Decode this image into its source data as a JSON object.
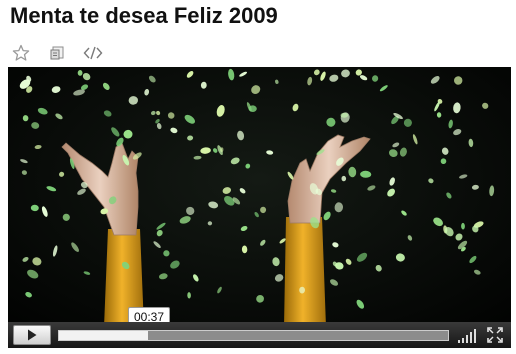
{
  "page": {
    "title": "Menta te desea Feliz 2009"
  },
  "toolbar": {
    "items": [
      {
        "name": "favorite",
        "icon": "star-icon"
      },
      {
        "name": "share",
        "icon": "share-icon"
      },
      {
        "name": "embed",
        "icon": "embed-code-icon"
      }
    ]
  },
  "player": {
    "current_time": "00:37",
    "progress": 0.23,
    "play_icon": "play-icon",
    "volume_icon": "volume-bars-icon",
    "fullscreen_icon": "fullscreen-icon"
  },
  "colors": {
    "accent": "#000000",
    "sleeve": "#e0a21e",
    "confetti": "#b8f2a4"
  }
}
